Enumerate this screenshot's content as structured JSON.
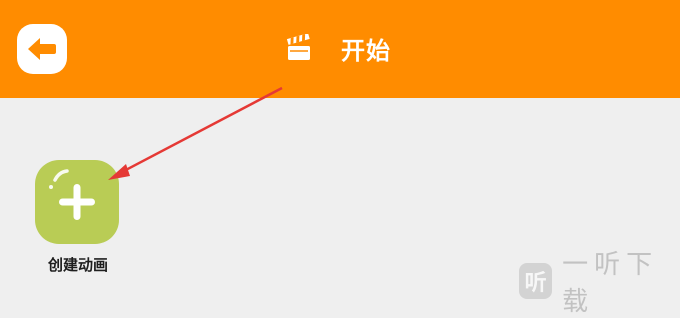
{
  "header": {
    "title": "开始",
    "back_icon": "back-arrow-icon",
    "title_icon": "clapperboard-icon",
    "background_color": "#ff8c00"
  },
  "main": {
    "create_button": {
      "label": "创建动画",
      "icon": "plus-icon",
      "color": "#b9cc55"
    },
    "annotation_arrow_color": "#e53935"
  },
  "watermark": {
    "logo_glyph": "听",
    "text": "一听下载"
  }
}
